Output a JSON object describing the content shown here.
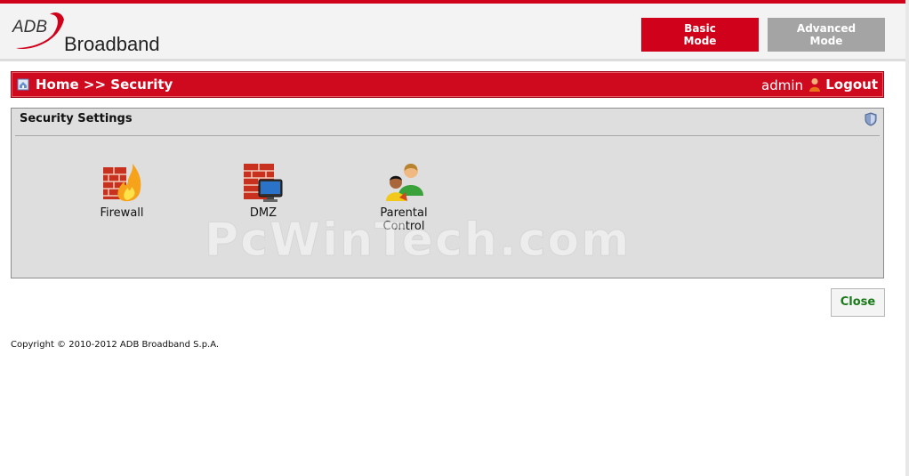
{
  "brand": {
    "mark": "ADB",
    "name": "Broadband"
  },
  "modes": {
    "basic": {
      "line1": "Basic",
      "line2": "Mode"
    },
    "advanced": {
      "line1": "Advanced",
      "line2": "Mode"
    }
  },
  "nav": {
    "home": "Home",
    "separator": ">>",
    "current": "Security",
    "user": "admin",
    "logout": "Logout"
  },
  "panel": {
    "title": "Security Settings",
    "items": [
      {
        "label": "Firewall",
        "icon": "firewall-icon"
      },
      {
        "label": "DMZ",
        "icon": "dmz-icon"
      },
      {
        "label": "Parental Control",
        "icon": "parental-control-icon"
      }
    ]
  },
  "watermark": "PcWinTech.com",
  "close_label": "Close",
  "footer": {
    "copyright": "Copyright © 2010-2012 ADB Broadband S.p.A."
  },
  "colors": {
    "brand_red": "#d0021b",
    "panel_bg": "#dedede",
    "close_green": "#1a7a1a"
  }
}
